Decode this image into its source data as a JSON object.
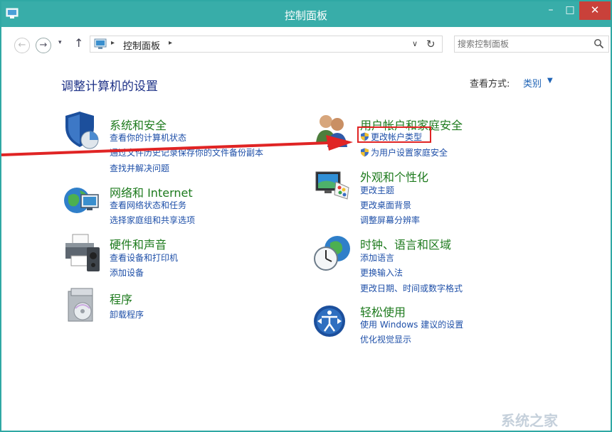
{
  "window": {
    "title": "控制面板"
  },
  "window_controls": {
    "minimize": "–",
    "maximize": "□",
    "close": "✕"
  },
  "nav": {
    "back": "←",
    "forward": "→",
    "dropdown": "▾",
    "up": "↑"
  },
  "address": {
    "separator": "▸",
    "crumb": "控制面板",
    "dropdown": "∨",
    "refresh": "↻"
  },
  "search": {
    "placeholder": "搜索控制面板"
  },
  "main": {
    "heading": "调整计算机的设置",
    "view_by_label": "查看方式:",
    "view_by_value": "类别",
    "view_by_caret": "▼"
  },
  "categories": [
    {
      "title": "系统和安全",
      "icon": "shield-icon",
      "links": [
        "查看你的计算机状态",
        "通过文件历史记录保存你的文件备份副本",
        "查找并解决问题"
      ]
    },
    {
      "title": "网络和 Internet",
      "icon": "network-globe-icon",
      "links": [
        "查看网络状态和任务",
        "选择家庭组和共享选项"
      ]
    },
    {
      "title": "硬件和声音",
      "icon": "printer-icon",
      "links": [
        "查看设备和打印机",
        "添加设备"
      ]
    },
    {
      "title": "程序",
      "icon": "programs-box-icon",
      "links": [
        "卸载程序"
      ]
    },
    {
      "title": "用户帐户和家庭安全",
      "icon": "users-icon",
      "links": [
        "更改帐户类型",
        "为用户设置家庭安全"
      ]
    },
    {
      "title": "外观和个性化",
      "icon": "monitor-palette-icon",
      "links": [
        "更改主题",
        "更改桌面背景",
        "调整屏幕分辨率"
      ]
    },
    {
      "title": "时钟、语言和区域",
      "icon": "clock-globe-icon",
      "links": [
        "添加语言",
        "更换输入法",
        "更改日期、时间或数字格式"
      ]
    },
    {
      "title": "轻松使用",
      "icon": "ease-of-access-icon",
      "links": [
        "使用 Windows 建议的设置",
        "优化视觉显示"
      ]
    }
  ],
  "watermark": {
    "text": "系统之家"
  },
  "colors": {
    "titlebar": "#38ada9",
    "close": "#c9413a",
    "category_title": "#1d7a1d",
    "link": "#1e4fa8",
    "heading": "#1e3287",
    "highlight": "#e02424",
    "arrow": "#e02424"
  }
}
